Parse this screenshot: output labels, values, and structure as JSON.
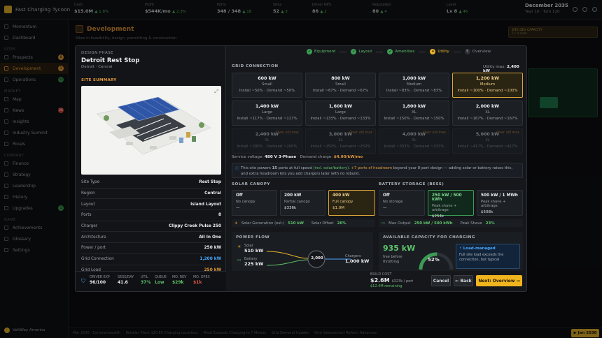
{
  "app": {
    "name": "Fast Charging Tycoon"
  },
  "topbar": {
    "stats": [
      {
        "key": "Cash",
        "value": "$15.0M",
        "delta": "▲ 1.8%"
      },
      {
        "key": "Profit",
        "value": "$544K/mo",
        "delta": "▲ 2.3%"
      },
      {
        "key": "Ports",
        "value": "348 / 348",
        "delta": "▲ 18"
      },
      {
        "key": "Sites",
        "value": "52",
        "delta": "▲ 3"
      },
      {
        "key": "Driver NPS",
        "value": "86",
        "delta": "▲ 2"
      },
      {
        "key": "Reputation",
        "value": "80",
        "delta": "▲ 4"
      },
      {
        "key": "Level",
        "value": "Lv 8",
        "delta": "▲ 46"
      }
    ],
    "date": "December 2035",
    "date_sub": "Year 10 · Turn 120"
  },
  "sidebar": {
    "items_top": [
      {
        "label": "Momentum"
      },
      {
        "label": "Dashboard"
      }
    ],
    "sec_sites": "SITES",
    "items_sites": [
      {
        "label": "Prospects",
        "badge": "8"
      },
      {
        "label": "Development",
        "badge": "1"
      },
      {
        "label": "Operations",
        "badge": "52"
      }
    ],
    "sec_market": "MARKET",
    "items_market": [
      {
        "label": "Map"
      },
      {
        "label": "News",
        "badge": "26"
      },
      {
        "label": "Insights"
      },
      {
        "label": "Industry Summit"
      },
      {
        "label": "Rivals"
      }
    ],
    "sec_company": "COMPANY",
    "items_company": [
      {
        "label": "Finance"
      },
      {
        "label": "Strategy"
      },
      {
        "label": "Leadership"
      },
      {
        "label": "History"
      },
      {
        "label": "Upgrades",
        "badge": "1"
      }
    ],
    "sec_game": "GAME",
    "items_game": [
      {
        "label": "Achievements"
      },
      {
        "label": "Glossary"
      },
      {
        "label": "Settings"
      }
    ],
    "footer": "VoltWay America"
  },
  "background": {
    "title": "Development",
    "subtitle": "Sites in feasibility, design, permitting & construction",
    "capacity_label": "SITE DEV CAPACITY",
    "capacity_value": "2 / 4 slots",
    "ticker": [
      "Mar 2036 · Commonwealth",
      "Retailer Plans 120 EV Charging Locations",
      "Rival Expands Charging to 7 Metros",
      "Grid Demand Update",
      "Grid Interconnect Reform Advances"
    ],
    "ticker_button": "▶ Jan 2036"
  },
  "modal": {
    "phase_label": "DESIGN PHASE",
    "site_name": "Detroit Rest Stop",
    "site_location": "Detroit · Central",
    "summary_label": "SITE SUMMARY",
    "specs": [
      {
        "k": "Site Type",
        "v": "Rest Stop"
      },
      {
        "k": "Region",
        "v": "Central"
      },
      {
        "k": "Layout",
        "v": "Island Layout"
      },
      {
        "k": "Ports",
        "v": "8"
      },
      {
        "k": "Charger",
        "v": "Clippy Creek Pulse 250"
      },
      {
        "k": "Architecture",
        "v": "All In One"
      },
      {
        "k": "Power / port",
        "v": "250 kW"
      },
      {
        "k": "Grid Connection",
        "v": "1,200 kW"
      },
      {
        "k": "Grid Load",
        "v": "250 kW"
      }
    ],
    "footer_stats": [
      {
        "k": "DRIVER EXP",
        "v": "96/100"
      },
      {
        "k": "SESS/DAY",
        "v": "41.6"
      },
      {
        "k": "UTIL",
        "v": "37%"
      },
      {
        "k": "QUEUE",
        "v": "Low"
      },
      {
        "k": "MO. REV",
        "v": "$29k"
      },
      {
        "k": "MO. OPEX",
        "v": "$1k"
      },
      {
        "k": "MO. PROFIT",
        "v": "$27k"
      },
      {
        "k": "PAYBACK*",
        "v": "8.5 yr"
      }
    ],
    "steps": [
      {
        "label": "Equipment",
        "mark": "✓"
      },
      {
        "label": "Layout",
        "mark": "✓"
      },
      {
        "label": "Amenities",
        "mark": "✓"
      },
      {
        "label": "Utility",
        "mark": "4"
      },
      {
        "label": "Overview",
        "mark": "5"
      }
    ],
    "utility_max_label": "Utility max:",
    "utility_max_value": "2,400 kW",
    "grid_label": "GRID CONNECTION",
    "grid_options": [
      {
        "a": "600 kW",
        "b": "Small",
        "c": "Install ~50% · Demand ~50%"
      },
      {
        "a": "800 kW",
        "b": "Small",
        "c": "Install ~67% · Demand ~67%"
      },
      {
        "a": "1,000 kW",
        "b": "Medium",
        "c": "Install ~83% · Demand ~83%"
      },
      {
        "a": "1,200 kW",
        "b": "Medium",
        "c": "Install ~100% · Demand ~100%"
      },
      {
        "a": "1,400 kW",
        "b": "Large",
        "c": "Install ~117% · Demand ~117%"
      },
      {
        "a": "1,600 kW",
        "b": "Large",
        "c": "Install ~133% · Demand ~133%"
      },
      {
        "a": "1,800 kW",
        "b": "XL",
        "c": "Install ~150% · Demand ~150%"
      },
      {
        "a": "2,000 kW",
        "b": "XL",
        "c": "Install ~167% · Demand ~167%"
      },
      {
        "a": "2,400 kW",
        "b": "XL",
        "c": "Install ~200% · Demand ~200%",
        "over": "Over util max"
      },
      {
        "a": "3,000 kW",
        "b": "XL",
        "c": "Install ~250% · Demand ~250%",
        "over": "Over util max"
      },
      {
        "a": "4,000 kW",
        "b": "XL",
        "c": "Install ~333% · Demand ~333%",
        "over": "Over util max"
      },
      {
        "a": "5,000 kW",
        "b": "XL",
        "c": "Install ~417% · Demand ~417%",
        "over": "Over util max"
      }
    ],
    "service_voltage": "Service voltage:",
    "service_voltage_val": "480 V 3-Phase",
    "demand_charge_lbl": "· Demand charge:",
    "demand_charge_val": "$4.00/kW/mo",
    "note_a": "This site powers ",
    "note_ports": "15",
    "note_b": " ports at full speed ",
    "note_c": "(incl. solar/battery)",
    "note_d": ". +7 ports of headroom",
    "note_e": " beyond your 8-port design — adding solar or battery raises this, and extra headroom lets you add chargers later with no rebuild.",
    "solar_label": "SOLAR CANOPY",
    "solar_options": [
      {
        "a": "Off",
        "b": "No canopy",
        "c": "—"
      },
      {
        "a": "200 kW",
        "b": "Partial canopy",
        "c": "$336k"
      },
      {
        "a": "400 kW",
        "b": "Full canopy",
        "c": "$1.0M"
      }
    ],
    "solar_gen_lbl": "Solar Generation (est.)",
    "solar_gen_val": "510 kW",
    "solar_off_lbl": "Solar Offset",
    "solar_off_val": "26%",
    "battery_label": "BATTERY STORAGE (BESS)",
    "battery_options": [
      {
        "a": "Off",
        "b": "No storage",
        "c": "—"
      },
      {
        "a": "250 kW / 500 kWh",
        "b": "Peak shave + arbitrage",
        "c": "$254k"
      },
      {
        "a": "500 kW / 1 MWh",
        "b": "Peak shave + arbitrage",
        "c": "$508k"
      }
    ],
    "max_out_lbl": "Max Output",
    "max_out_val": "250 kW / 500 kWh",
    "peak_shave_lbl": "Peak Shave",
    "peak_shave_val": "23%",
    "pf_label": "POWER FLOW",
    "pf_solar_lbl": "Solar",
    "pf_solar_val": "510 kW",
    "pf_battery_lbl": "Battery",
    "pf_battery_val": "225 kW",
    "pf_grid_val": "2,000",
    "pf_chargers_lbl": "Chargers",
    "pf_chargers_val": "1,000 kW",
    "cap_label": "AVAILABLE CAPACITY FOR CHARGING",
    "cap_value": "935 kW",
    "cap_sub1": "free before",
    "cap_sub2": "throttling",
    "cap_pct": "52%",
    "cap_pct_frac": 0.52,
    "load_title": "Load-managed",
    "load_text1": "Full site load exceeds the",
    "load_text2": "connection, but typical",
    "build_cost_lbl": "BUILD COST",
    "build_cost_val": "$2.6M",
    "build_cost_port": "$323k / port",
    "build_remaining": "$12.4M remaining",
    "cancel_label": "Cancel",
    "back_label": "← Back",
    "next_label": "Next: Overview →"
  },
  "colors": {
    "accent": "#e39a3a",
    "selected": "#d9a43a",
    "green": "#3c9b54",
    "blue": "#4aa8ff"
  }
}
